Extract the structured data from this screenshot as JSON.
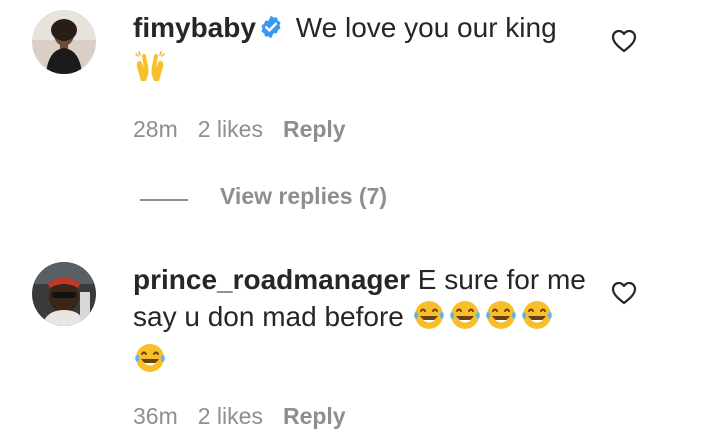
{
  "comments": [
    {
      "username": "fimybaby",
      "verified": true,
      "text": "We love you our king",
      "emoji": [
        "raising-hands"
      ],
      "time": "28m",
      "likes": "2 likes",
      "reply_label": "Reply"
    },
    {
      "username": "prince_roadmanager",
      "verified": false,
      "text_line1": "E sure for me",
      "text_line2": "say u don mad before",
      "emoji": [
        "face-with-tears-of-joy",
        "face-with-tears-of-joy",
        "face-with-tears-of-joy",
        "face-with-tears-of-joy",
        "face-with-tears-of-joy"
      ],
      "time": "36m",
      "likes": "2 likes",
      "reply_label": "Reply"
    }
  ],
  "view_replies": {
    "label": "View replies (7)"
  },
  "colors": {
    "text": "#262626",
    "meta": "#8e8e8e",
    "verified": "#3897f0",
    "emoji_face": "#f7c02b"
  },
  "icons": {
    "like": "heart-outline-icon",
    "verified": "verified-badge-icon"
  }
}
